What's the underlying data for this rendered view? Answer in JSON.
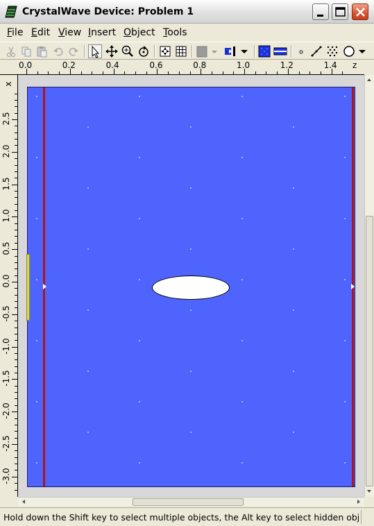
{
  "window": {
    "title": "CrystalWave Device: Problem 1",
    "icon": "crystalwave-app-icon",
    "controls": [
      "minimize-icon",
      "maximize-icon",
      "close-icon"
    ]
  },
  "menu": {
    "items": [
      {
        "label": "File",
        "mnemonic": "F"
      },
      {
        "label": "Edit",
        "mnemonic": "E"
      },
      {
        "label": "View",
        "mnemonic": "V"
      },
      {
        "label": "Insert",
        "mnemonic": "I"
      },
      {
        "label": "Object",
        "mnemonic": "O"
      },
      {
        "label": "Tools",
        "mnemonic": "T"
      }
    ]
  },
  "toolbar": {
    "icons": [
      "cut-icon",
      "copy-icon",
      "paste-icon",
      "undo-icon",
      "redo-icon",
      "select-arrow-icon",
      "pan-icon",
      "zoom-icon",
      "rotate-icon",
      "snap-icon",
      "grid-icon",
      "fill-color-icon",
      "port-icon",
      "fill-pattern-icon",
      "waveguide-icon",
      "point-icon",
      "line-icon",
      "lattice-icon",
      "ellipse-tool-icon"
    ]
  },
  "ruler_top": {
    "labels": [
      "0.0",
      "0.2",
      "0.4",
      "0.6",
      "0.8",
      "1.0",
      "1.2",
      "1.4"
    ],
    "axis_label": "z"
  },
  "ruler_left": {
    "axis_label": "x",
    "labels": [
      "2.5",
      "2.0",
      "1.5",
      "1.0",
      "0.5",
      "0.0",
      "-0.5",
      "-1.0",
      "-1.5",
      "-2.0",
      "-2.5",
      "-3.0"
    ]
  },
  "canvas": {
    "background_color": "#4f64fc",
    "boundary_color": "#b01418",
    "ellipse_color": "#ffffff",
    "launch_field_color": "#d9d94a",
    "object": "ellipse"
  },
  "scroll": {
    "vertical_position": 0.5,
    "horizontal_position": 0.3
  },
  "status": {
    "text": "Hold down the Shift key to select multiple objects, the Alt key to select hidden objec"
  }
}
